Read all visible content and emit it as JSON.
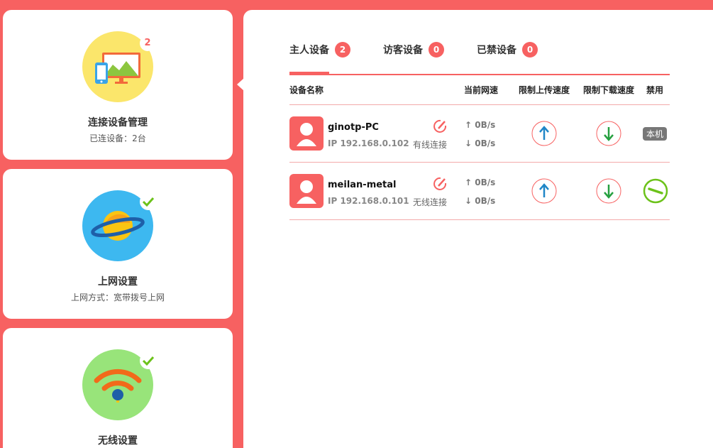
{
  "sidebar": {
    "cards": [
      {
        "title": "连接设备管理",
        "subtitle": "已连设备：2台",
        "badge": "2"
      },
      {
        "title": "上网设置",
        "subtitle": "上网方式：宽带拨号上网"
      },
      {
        "title": "无线设置"
      }
    ]
  },
  "tabs": [
    {
      "label": "主人设备",
      "count": "2"
    },
    {
      "label": "访客设备",
      "count": "0"
    },
    {
      "label": "已禁设备",
      "count": "0"
    }
  ],
  "table": {
    "headers": {
      "name": "设备名称",
      "speed": "当前网速",
      "up_limit": "限制上传速度",
      "down_limit": "限制下载速度",
      "ban": "禁用"
    },
    "rows": [
      {
        "name": "ginotp-PC",
        "ip": "IP 192.168.0.102",
        "conn": "有线连接",
        "up": "0B/s",
        "down": "0B/s",
        "ban": "本机"
      },
      {
        "name": "meilan-metal",
        "ip": "IP 192.168.0.101",
        "conn": "无线连接",
        "up": "0B/s",
        "down": "0B/s"
      }
    ]
  },
  "colors": {
    "accent": "#f76161",
    "up_arrow": "#1f86c7",
    "down_arrow": "#26a040",
    "ban_green": "#6cc21a"
  }
}
